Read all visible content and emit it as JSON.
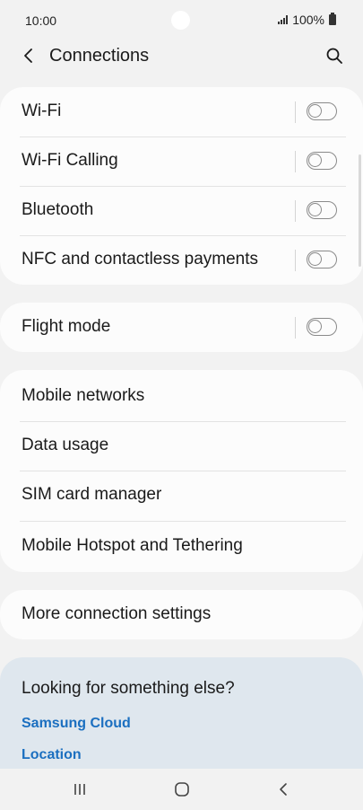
{
  "status_bar": {
    "time": "10:00",
    "battery": "100%"
  },
  "header": {
    "title": "Connections"
  },
  "section_toggles": [
    {
      "label": "Wi-Fi",
      "on": false
    },
    {
      "label": "Wi-Fi Calling",
      "on": false
    },
    {
      "label": "Bluetooth",
      "on": false
    },
    {
      "label": "NFC and contactless payments",
      "on": false
    }
  ],
  "flight_mode": {
    "label": "Flight mode",
    "on": false
  },
  "section_links": [
    {
      "label": "Mobile networks"
    },
    {
      "label": "Data usage"
    },
    {
      "label": "SIM card manager"
    },
    {
      "label": "Mobile Hotspot and Tethering"
    }
  ],
  "more_settings": {
    "label": "More connection settings"
  },
  "suggestions": {
    "title": "Looking for something else?",
    "links": [
      "Samsung Cloud",
      "Location"
    ]
  },
  "colors": {
    "background": "#f2f2f2",
    "card": "#fcfcfc",
    "suggest_card": "#dfe7ee",
    "link": "#1b6fc0"
  },
  "nav_bar": {
    "icons": [
      "recent-apps-icon",
      "home-icon",
      "back-icon"
    ]
  }
}
